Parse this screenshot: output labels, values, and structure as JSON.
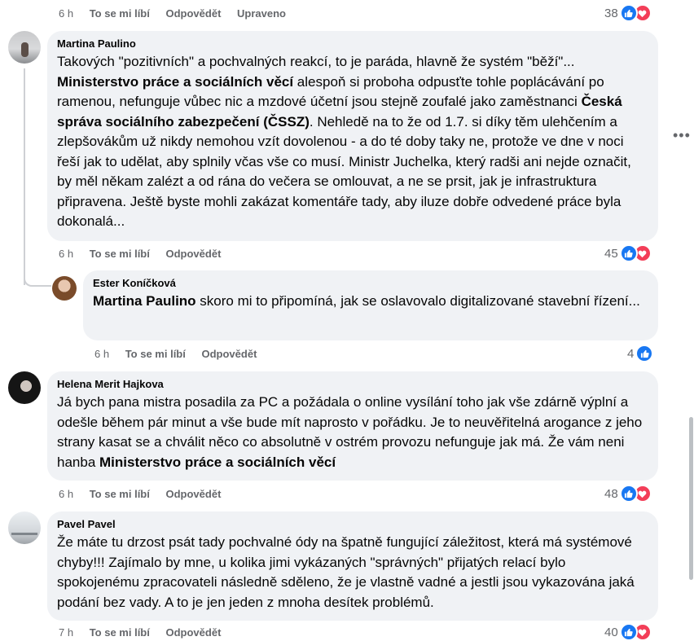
{
  "top_row": {
    "time": "6 h",
    "like": "To se mi líbí",
    "reply": "Odpovědět",
    "edited": "Upraveno",
    "reactions": "38"
  },
  "comments": [
    {
      "author": "Martina Paulino",
      "text_parts": [
        "Takových \"pozitivních\" a pochvalných reakcí, to je paráda, hlavně že systém \"běží\"...",
        "Ministerstvo práce a sociálních věcí",
        " alespoň si proboha odpusťte tohle poplácávání po ramenou, nefunguje vůbec nic a mzdové účetní jsou stejně zoufalé jako zaměstnanci",
        "Česká správa sociálního zabezpečení (ČSSZ)",
        ". Nehledě na to že od 1.7. si díky těm ulehčením a zlepšovákům už nikdy nemohou vzít dovolenou - a do té doby taky ne, protože ve dne v noci řeší jak to udělat, aby splnily včas vše co musí. Ministr Juchelka, který radši ani nejde označit, by měl někam zalézt a od rána do večera se omlouvat, a ne se prsit, jak je infrastruktura připravena. Ještě byste mohli zakázat komentáře tady, aby iluze dobře odvedené práce byla dokonalá..."
      ],
      "time": "6 h",
      "like": "To se mi líbí",
      "reply": "Odpovědět",
      "reactions": "45"
    },
    {
      "author": "Ester Koníčková",
      "mention": "Martina Paulino",
      "text": " skoro mi to připomíná, jak se oslavovalo digitalizované stavební řízení...",
      "time": "6 h",
      "like": "To se mi líbí",
      "reply": "Odpovědět",
      "reactions": "4"
    },
    {
      "author": "Helena Merit Hajkova",
      "text": "Já bych pana mistra posadila za PC a požádala o online vysílání toho jak vše zdárně výplní a odešle během pár minut a vše bude mít naprosto v pořádku. Je to neuvěřitelná arogance z jeho strany kasat se a chválit něco co absolutně v ostrém provozu nefunguje jak má. Že vám neni hanba ",
      "mention": "Ministerstvo práce a sociálních věcí",
      "time": "6 h",
      "like": "To se mi líbí",
      "reply": "Odpovědět",
      "reactions": "48"
    },
    {
      "author": "Pavel Pavel",
      "text": "Že máte tu drzost psát tady pochvalné ódy na špatně fungující záležitost, která má systémové chyby!!! Zajímalo by mne, u kolika jimi vykázaných \"správných\" přijatých relací bylo spokojenému zpracovateli následně sděleno, že je vlastně vadné a jestli jsou vykazována jaká podání bez vady. A to je jen jeden z mnoha desítek problémů.",
      "time": "7 h",
      "like": "To se mi líbí",
      "reply": "Odpovědět",
      "reactions": "40"
    }
  ],
  "colors": {
    "like": "#1877f2",
    "love": "#f33e58",
    "bubble": "#f0f2f5",
    "meta": "#65676b"
  },
  "icons": [
    "like-icon",
    "love-icon",
    "more-options-icon"
  ]
}
